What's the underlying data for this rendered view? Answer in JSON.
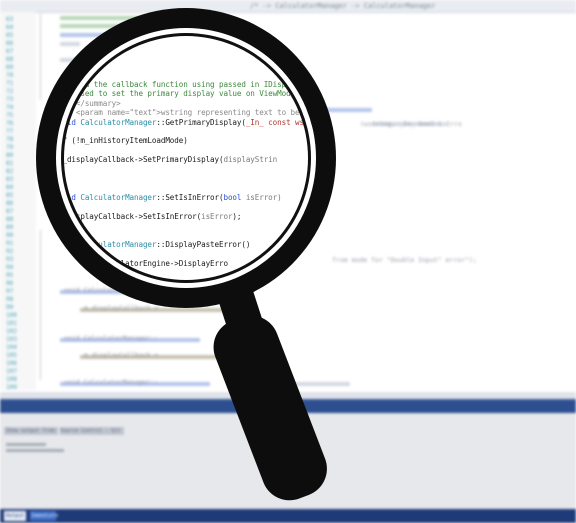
{
  "scene": {
    "title_fragment": "/* -> CalculatorManager  -> CalculatorManager"
  },
  "background_code": {
    "line_numbers": [
      "63",
      "64",
      "65",
      "66",
      "67",
      "68",
      "69",
      "70",
      "71",
      "72",
      "73",
      "74",
      "75",
      "76",
      "77",
      "78",
      "79",
      "80",
      "81",
      "82",
      "83",
      "84",
      "85",
      "86",
      "87",
      "88",
      "89",
      "90",
      "91",
      "92",
      "93",
      "94",
      "95",
      "96",
      "97",
      "98",
      "99",
      "100",
      "101",
      "102",
      "103",
      "104",
      "105",
      "106",
      "107",
      "108",
      "109"
    ],
    "right_fragment": "(wstring, _In_ bool isErro",
    "paste_error_fragment": "from mode for \"Double Input\" error\");",
    "lower_lines": [
      "void CalculatorManager::",
      "m_displayCallback->",
      "void CalculatorManager::",
      "m_displayCallback->",
      "void CalculatorManager::"
    ]
  },
  "magnified_code": {
    "lines": [
      {
        "parts": [
          {
            "t": "// Send the callback function using passed in IDisp",
            "c": "c-comment"
          }
        ]
      },
      {
        "parts": [
          {
            "t": "/// used to set the primary display value on ViewMod",
            "c": "c-comment"
          }
        ]
      },
      {
        "parts": [
          {
            "t": "/// </summary>",
            "c": "c-gray"
          }
        ]
      },
      {
        "parts": [
          {
            "t": "/// <param name=\"text\">wstring representing text to be",
            "c": "c-gray"
          }
        ]
      },
      {
        "parts": [
          {
            "t": "void ",
            "c": "c-kw"
          },
          {
            "t": "CalculatorManager",
            "c": "c-type"
          },
          {
            "t": "::GetPrimaryDisplay(",
            "c": "c-plain"
          },
          {
            "t": "_In_ const wst",
            "c": "c-red"
          }
        ]
      },
      {
        "parts": [
          {
            "t": "{",
            "c": "c-plain"
          }
        ]
      },
      {
        "parts": [
          {
            "t": "    if (!m_inHistoryItemLoadMode)",
            "c": "c-plain"
          }
        ]
      },
      {
        "parts": [
          {
            "t": "    {",
            "c": "c-plain"
          }
        ]
      },
      {
        "parts": [
          {
            "t": "        m_displayCallback->SetPrimaryDisplay(",
            "c": "c-plain"
          },
          {
            "t": "displayStrin",
            "c": "c-param"
          }
        ]
      },
      {
        "parts": [
          {
            "t": "    }",
            "c": "c-plain"
          }
        ]
      },
      {
        "parts": [
          {
            "t": "}",
            "c": "c-plain"
          }
        ]
      },
      {
        "parts": [
          {
            "t": "",
            "c": "c-plain"
          }
        ]
      },
      {
        "parts": [
          {
            "t": "void ",
            "c": "c-kw"
          },
          {
            "t": "CalculatorManager",
            "c": "c-type"
          },
          {
            "t": "::SetIsInError(",
            "c": "c-plain"
          },
          {
            "t": "bool ",
            "c": "c-kw"
          },
          {
            "t": "isError)",
            "c": "c-param"
          }
        ]
      },
      {
        "parts": [
          {
            "t": "{",
            "c": "c-plain"
          }
        ]
      },
      {
        "parts": [
          {
            "t": "    m_displayCallback->SetIsInError(",
            "c": "c-plain"
          },
          {
            "t": "isError",
            "c": "c-param"
          },
          {
            "t": ");",
            "c": "c-plain"
          }
        ]
      },
      {
        "parts": [
          {
            "t": "}",
            "c": "c-plain"
          }
        ]
      },
      {
        "parts": [
          {
            "t": "",
            "c": "c-plain"
          }
        ]
      },
      {
        "parts": [
          {
            "t": "void ",
            "c": "c-kw"
          },
          {
            "t": "CalculatorManager",
            "c": "c-type"
          },
          {
            "t": "::DisplayPasteError()",
            "c": "c-plain"
          }
        ]
      },
      {
        "parts": [
          {
            "t": "{",
            "c": "c-plain"
          }
        ]
      },
      {
        "parts": [
          {
            "t": "    m_currentCalculatorEngine->DisplayErro",
            "c": "c-plain"
          }
        ]
      }
    ]
  },
  "panel": {
    "tab_labels": [
      "Output",
      "Immediate"
    ],
    "dropdown_text": "Show output from:  Source Control - Git"
  },
  "colors": {
    "magnifier": "#0d0d0d",
    "accent_blue": "#2d4f8f"
  }
}
